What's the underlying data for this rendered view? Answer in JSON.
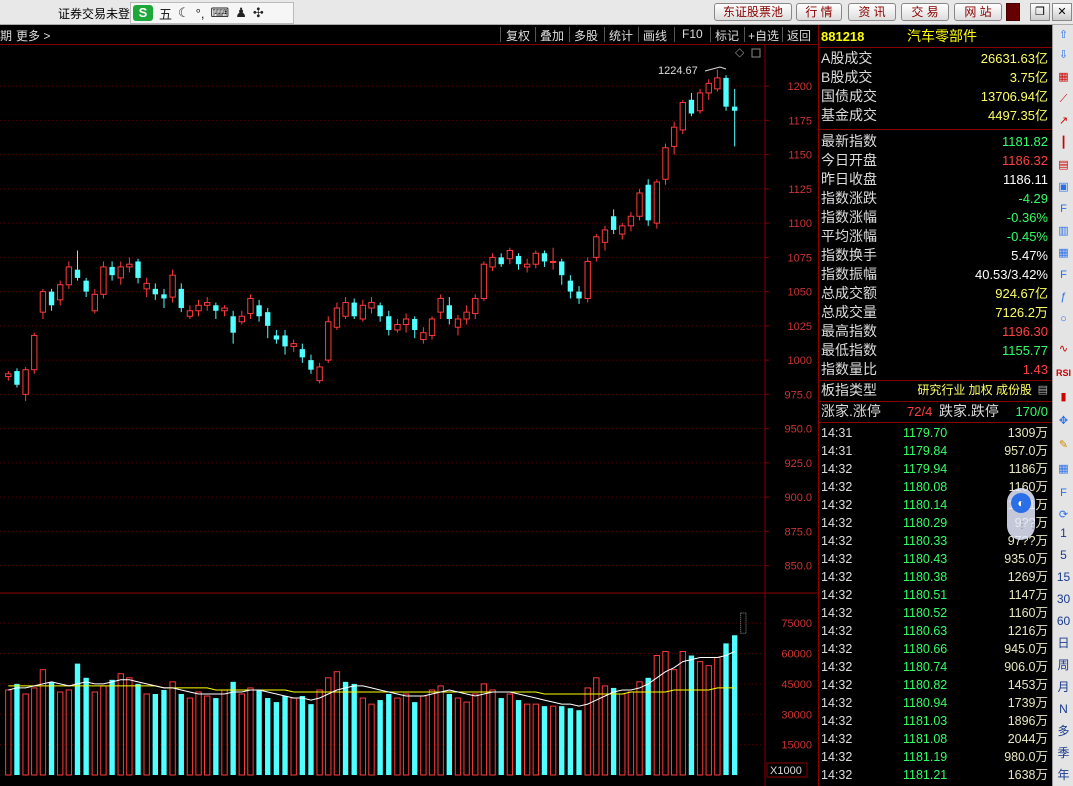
{
  "window": {
    "title": "证券交易未登",
    "ime": {
      "logo": "S",
      "mode": "五"
    },
    "top_buttons": [
      "东证股票池",
      "行 情",
      "资 讯",
      "交 易",
      "网 站"
    ]
  },
  "toolbar": {
    "left": [
      "期",
      "更多 >"
    ],
    "right": [
      "复权",
      "叠加",
      "多股",
      "统计",
      "画线",
      "F10",
      "标记",
      "+自选",
      "返回"
    ]
  },
  "price_axis": [
    "1200",
    "1175",
    "1150",
    "1125",
    "1100",
    "1075",
    "1050",
    "1025",
    "1000",
    "975.0",
    "950.0",
    "925.0",
    "900.0",
    "875.0",
    "850.0"
  ],
  "volume_axis": [
    "75000",
    "60000",
    "45000",
    "30000",
    "15000"
  ],
  "volume_unit": "X1000",
  "high_marker": "1224.67",
  "colors": {
    "up": "#ff3b3b",
    "down": "#50ffff",
    "ma_white": "#ffffff",
    "ma_yellow": "#ffff00",
    "green": "#33ff66",
    "red": "#ff4040"
  },
  "chart_data": {
    "type": "candlestick",
    "price_range": [
      830,
      1230
    ],
    "volume_range": [
      0,
      80000
    ],
    "candles": [
      [
        988,
        990,
        985,
        992,
        "up"
      ],
      [
        992,
        982,
        980,
        994,
        "down"
      ],
      [
        975,
        993,
        970,
        995,
        "up"
      ],
      [
        993,
        1018,
        990,
        1020,
        "up"
      ],
      [
        1035,
        1050,
        1030,
        1052,
        "up"
      ],
      [
        1050,
        1040,
        1036,
        1052,
        "down"
      ],
      [
        1044,
        1055,
        1040,
        1058,
        "up"
      ],
      [
        1055,
        1068,
        1052,
        1072,
        "up"
      ],
      [
        1066,
        1060,
        1058,
        1080,
        "down"
      ],
      [
        1058,
        1050,
        1046,
        1060,
        "down"
      ],
      [
        1036,
        1048,
        1034,
        1052,
        "up"
      ],
      [
        1048,
        1068,
        1045,
        1072,
        "up"
      ],
      [
        1068,
        1062,
        1058,
        1072,
        "down"
      ],
      [
        1060,
        1068,
        1055,
        1072,
        "up"
      ],
      [
        1068,
        1070,
        1064,
        1075,
        "up"
      ],
      [
        1072,
        1060,
        1056,
        1074,
        "down"
      ],
      [
        1052,
        1056,
        1046,
        1060,
        "up"
      ],
      [
        1052,
        1048,
        1044,
        1056,
        "down"
      ],
      [
        1048,
        1045,
        1038,
        1052,
        "down"
      ],
      [
        1046,
        1062,
        1042,
        1066,
        "up"
      ],
      [
        1052,
        1038,
        1035,
        1056,
        "down"
      ],
      [
        1032,
        1036,
        1030,
        1040,
        "up"
      ],
      [
        1036,
        1040,
        1032,
        1044,
        "up"
      ],
      [
        1040,
        1042,
        1036,
        1046,
        "up"
      ],
      [
        1040,
        1036,
        1030,
        1042,
        "down"
      ],
      [
        1036,
        1038,
        1032,
        1040,
        "up"
      ],
      [
        1032,
        1020,
        1012,
        1036,
        "down"
      ],
      [
        1028,
        1032,
        1026,
        1036,
        "up"
      ],
      [
        1034,
        1045,
        1030,
        1048,
        "up"
      ],
      [
        1040,
        1032,
        1028,
        1044,
        "down"
      ],
      [
        1035,
        1025,
        1016,
        1038,
        "down"
      ],
      [
        1018,
        1015,
        1012,
        1022,
        "down"
      ],
      [
        1018,
        1010,
        1004,
        1022,
        "down"
      ],
      [
        1010,
        1012,
        1006,
        1015,
        "up"
      ],
      [
        1008,
        1002,
        998,
        1012,
        "down"
      ],
      [
        1000,
        993,
        990,
        1004,
        "down"
      ],
      [
        985,
        995,
        983,
        998,
        "up"
      ],
      [
        1000,
        1028,
        998,
        1032,
        "up"
      ],
      [
        1024,
        1038,
        1022,
        1042,
        "up"
      ],
      [
        1032,
        1042,
        1030,
        1046,
        "up"
      ],
      [
        1042,
        1032,
        1030,
        1045,
        "down"
      ],
      [
        1030,
        1040,
        1028,
        1044,
        "up"
      ],
      [
        1038,
        1042,
        1034,
        1046,
        "up"
      ],
      [
        1040,
        1032,
        1028,
        1042,
        "down"
      ],
      [
        1032,
        1022,
        1018,
        1036,
        "down"
      ],
      [
        1022,
        1026,
        1020,
        1030,
        "up"
      ],
      [
        1026,
        1030,
        1020,
        1034,
        "up"
      ],
      [
        1030,
        1022,
        1016,
        1032,
        "down"
      ],
      [
        1015,
        1020,
        1012,
        1024,
        "up"
      ],
      [
        1018,
        1030,
        1015,
        1032,
        "up"
      ],
      [
        1035,
        1045,
        1030,
        1048,
        "up"
      ],
      [
        1040,
        1030,
        1026,
        1046,
        "down"
      ],
      [
        1024,
        1030,
        1018,
        1033,
        "up"
      ],
      [
        1030,
        1035,
        1026,
        1040,
        "up"
      ],
      [
        1034,
        1045,
        1030,
        1048,
        "up"
      ],
      [
        1045,
        1070,
        1043,
        1072,
        "up"
      ],
      [
        1068,
        1075,
        1065,
        1078,
        "up"
      ],
      [
        1075,
        1070,
        1068,
        1078,
        "down"
      ],
      [
        1074,
        1080,
        1070,
        1082,
        "up"
      ],
      [
        1076,
        1070,
        1066,
        1078,
        "down"
      ],
      [
        1068,
        1070,
        1064,
        1074,
        "up"
      ],
      [
        1070,
        1078,
        1067,
        1080,
        "up"
      ],
      [
        1078,
        1072,
        1068,
        1080,
        "down"
      ],
      [
        1072,
        1072,
        1066,
        1082,
        "up"
      ],
      [
        1072,
        1062,
        1055,
        1074,
        "down"
      ],
      [
        1058,
        1050,
        1045,
        1062,
        "down"
      ],
      [
        1050,
        1045,
        1041,
        1054,
        "down"
      ],
      [
        1045,
        1072,
        1042,
        1075,
        "up"
      ],
      [
        1075,
        1090,
        1072,
        1092,
        "up"
      ],
      [
        1086,
        1095,
        1080,
        1098,
        "up"
      ],
      [
        1105,
        1095,
        1092,
        1110,
        "down"
      ],
      [
        1092,
        1098,
        1088,
        1100,
        "up"
      ],
      [
        1098,
        1105,
        1094,
        1108,
        "up"
      ],
      [
        1105,
        1122,
        1102,
        1125,
        "up"
      ],
      [
        1128,
        1102,
        1098,
        1132,
        "down"
      ],
      [
        1100,
        1130,
        1096,
        1132,
        "up"
      ],
      [
        1132,
        1155,
        1128,
        1158,
        "up"
      ],
      [
        1156,
        1170,
        1150,
        1174,
        "up"
      ],
      [
        1168,
        1188,
        1165,
        1190,
        "up"
      ],
      [
        1190,
        1180,
        1178,
        1195,
        "down"
      ],
      [
        1182,
        1195,
        1180,
        1198,
        "up"
      ],
      [
        1195,
        1202,
        1190,
        1205,
        "up"
      ],
      [
        1198,
        1206,
        1196,
        1212,
        "up"
      ],
      [
        1206,
        1185,
        1182,
        1208,
        "down"
      ],
      [
        1185,
        1182,
        1156,
        1198,
        "down"
      ]
    ],
    "volumes": [
      [
        42,
        "up"
      ],
      [
        45,
        "down"
      ],
      [
        40,
        "up"
      ],
      [
        43,
        "up"
      ],
      [
        52,
        "up"
      ],
      [
        46,
        "down"
      ],
      [
        41,
        "up"
      ],
      [
        42,
        "up"
      ],
      [
        55,
        "down"
      ],
      [
        48,
        "down"
      ],
      [
        41,
        "up"
      ],
      [
        44,
        "up"
      ],
      [
        47,
        "down"
      ],
      [
        50,
        "up"
      ],
      [
        48,
        "up"
      ],
      [
        45,
        "down"
      ],
      [
        40,
        "up"
      ],
      [
        40,
        "down"
      ],
      [
        42,
        "down"
      ],
      [
        46,
        "up"
      ],
      [
        40,
        "down"
      ],
      [
        38,
        "up"
      ],
      [
        41,
        "up"
      ],
      [
        39,
        "up"
      ],
      [
        38,
        "down"
      ],
      [
        42,
        "up"
      ],
      [
        46,
        "down"
      ],
      [
        40,
        "up"
      ],
      [
        43,
        "up"
      ],
      [
        42,
        "down"
      ],
      [
        38,
        "down"
      ],
      [
        36,
        "down"
      ],
      [
        39,
        "down"
      ],
      [
        38,
        "up"
      ],
      [
        39,
        "down"
      ],
      [
        35,
        "down"
      ],
      [
        42,
        "up"
      ],
      [
        48,
        "up"
      ],
      [
        51,
        "up"
      ],
      [
        46,
        "down"
      ],
      [
        45,
        "down"
      ],
      [
        38,
        "up"
      ],
      [
        35,
        "up"
      ],
      [
        37,
        "down"
      ],
      [
        40,
        "down"
      ],
      [
        38,
        "up"
      ],
      [
        40,
        "up"
      ],
      [
        36,
        "down"
      ],
      [
        39,
        "up"
      ],
      [
        42,
        "up"
      ],
      [
        44,
        "up"
      ],
      [
        40,
        "down"
      ],
      [
        38,
        "up"
      ],
      [
        36,
        "up"
      ],
      [
        40,
        "up"
      ],
      [
        45,
        "up"
      ],
      [
        42,
        "up"
      ],
      [
        38,
        "down"
      ],
      [
        40,
        "up"
      ],
      [
        37,
        "down"
      ],
      [
        35,
        "up"
      ],
      [
        35,
        "up"
      ],
      [
        34,
        "down"
      ],
      [
        34,
        "up"
      ],
      [
        34,
        "down"
      ],
      [
        33,
        "down"
      ],
      [
        32,
        "down"
      ],
      [
        43,
        "up"
      ],
      [
        48,
        "up"
      ],
      [
        44,
        "up"
      ],
      [
        43,
        "down"
      ],
      [
        40,
        "up"
      ],
      [
        41,
        "up"
      ],
      [
        46,
        "up"
      ],
      [
        48,
        "down"
      ],
      [
        59,
        "up"
      ],
      [
        61,
        "up"
      ],
      [
        52,
        "up"
      ],
      [
        61,
        "up"
      ],
      [
        59,
        "down"
      ],
      [
        56,
        "up"
      ],
      [
        54,
        "up"
      ],
      [
        58,
        "up"
      ],
      [
        65,
        "down"
      ],
      [
        69,
        "down"
      ]
    ],
    "ma_white": [
      42,
      43,
      43,
      44,
      45,
      46,
      45,
      44,
      45,
      46,
      45,
      45,
      46,
      47,
      47,
      46,
      45,
      44,
      43,
      43,
      42,
      41,
      40,
      40,
      40,
      40,
      41,
      41,
      42,
      42,
      41,
      40,
      39,
      38,
      38,
      37,
      38,
      40,
      42,
      43,
      44,
      44,
      43,
      42,
      41,
      40,
      39,
      39,
      39,
      40,
      41,
      42,
      41,
      40,
      39,
      40,
      41,
      41,
      41,
      40,
      39,
      38,
      37,
      36,
      35,
      35,
      34,
      35,
      37,
      39,
      41,
      42,
      42,
      43,
      45,
      48,
      51,
      53,
      56,
      57,
      58,
      58,
      58,
      59,
      61
    ],
    "ma_yellow": [
      44,
      44,
      44,
      44,
      44,
      44,
      44,
      44,
      44,
      44,
      44,
      44,
      44,
      44,
      44,
      44,
      44,
      44,
      43,
      43,
      43,
      43,
      43,
      43,
      42,
      42,
      42,
      42,
      42,
      42,
      42,
      42,
      42,
      41,
      41,
      41,
      41,
      41,
      41,
      41,
      41,
      41,
      41,
      41,
      41,
      41,
      41,
      41,
      41,
      41,
      41,
      41,
      41,
      41,
      41,
      41,
      41,
      41,
      41,
      41,
      41,
      41,
      40,
      40,
      40,
      40,
      40,
      40,
      40,
      40,
      40,
      40,
      41,
      41,
      41,
      41,
      41,
      42,
      42,
      42,
      42,
      42,
      43,
      43,
      43
    ]
  },
  "panel": {
    "code": "881218",
    "name": "汽车零部件",
    "turnover": [
      {
        "label": "A股成交",
        "value": "26631.63亿"
      },
      {
        "label": "B股成交",
        "value": "3.75亿"
      },
      {
        "label": "国债成交",
        "value": "13706.94亿"
      },
      {
        "label": "基金成交",
        "value": "4497.35亿"
      }
    ],
    "quote": [
      {
        "label": "最新指数",
        "value": "1181.82",
        "color": "green"
      },
      {
        "label": "今日开盘",
        "value": "1186.32",
        "color": "red"
      },
      {
        "label": "昨日收盘",
        "value": "1186.11",
        "color": "white"
      },
      {
        "label": "指数涨跌",
        "value": "-4.29",
        "color": "green"
      },
      {
        "label": "指数涨幅",
        "value": "-0.36%",
        "color": "green"
      },
      {
        "label": "平均涨幅",
        "value": "-0.45%",
        "color": "green"
      },
      {
        "label": "指数换手",
        "value": "5.47%",
        "color": "white"
      },
      {
        "label": "指数振幅",
        "value": "40.53/3.42%",
        "color": "white"
      },
      {
        "label": "总成交额",
        "value": "924.67亿",
        "color": "yellow"
      },
      {
        "label": "总成交量",
        "value": "7126.2万",
        "color": "yellow"
      },
      {
        "label": "最高指数",
        "value": "1196.30",
        "color": "red"
      },
      {
        "label": "最低指数",
        "value": "1155.77",
        "color": "green"
      },
      {
        "label": "指数量比",
        "value": "1.43",
        "color": "red"
      }
    ],
    "board_type_label": "板指类型",
    "board_type_value": "研究行业 加权 成份股",
    "updown": {
      "label1": "涨家.涨停",
      "value1": "72/4",
      "label2": "跌家.跌停",
      "value2": "170/0"
    },
    "ticks": [
      [
        "14:31",
        "1179.70",
        "1309万"
      ],
      [
        "14:31",
        "1179.84",
        "957.0万"
      ],
      [
        "14:32",
        "1179.94",
        "1186万"
      ],
      [
        "14:32",
        "1180.08",
        "1160万"
      ],
      [
        "14:32",
        "1180.14",
        "1?51万"
      ],
      [
        "14:32",
        "1180.29",
        "9??万"
      ],
      [
        "14:32",
        "1180.33",
        "97??万"
      ],
      [
        "14:32",
        "1180.43",
        "935.0万"
      ],
      [
        "14:32",
        "1180.38",
        "1269万"
      ],
      [
        "14:32",
        "1180.51",
        "1147万"
      ],
      [
        "14:32",
        "1180.52",
        "1160万"
      ],
      [
        "14:32",
        "1180.63",
        "1216万"
      ],
      [
        "14:32",
        "1180.66",
        "945.0万"
      ],
      [
        "14:32",
        "1180.74",
        "906.0万"
      ],
      [
        "14:32",
        "1180.82",
        "1453万"
      ],
      [
        "14:32",
        "1180.94",
        "1739万"
      ],
      [
        "14:32",
        "1181.03",
        "1896万"
      ],
      [
        "14:32",
        "1181.08",
        "2044万"
      ],
      [
        "14:32",
        "1181.19",
        "980.0万"
      ],
      [
        "14:32",
        "1181.21",
        "1638万"
      ]
    ]
  },
  "sidebar": [
    "1",
    "5",
    "15",
    "30",
    "60",
    "日",
    "周",
    "月",
    "N",
    "多",
    "季",
    "年"
  ]
}
